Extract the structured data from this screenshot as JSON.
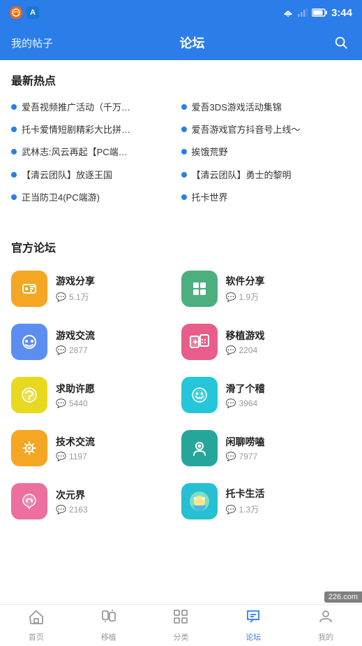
{
  "statusBar": {
    "time": "3:44",
    "icons": [
      "sohu",
      "a-blue"
    ]
  },
  "topNav": {
    "leftLabel": "我的帖子",
    "title": "论坛",
    "rightIcon": "search"
  },
  "hotSection": {
    "title": "最新热点",
    "items": [
      {
        "text": "爱吾视频推广活动（千万…"
      },
      {
        "text": "爱吾3DS游戏活动集锦"
      },
      {
        "text": "托卡爱情短剧精彩大比拼…"
      },
      {
        "text": "爱吾游戏官方抖音号上线～"
      },
      {
        "text": "武林志:风云再起【PC端…"
      },
      {
        "text": "挨饿荒野"
      },
      {
        "text": "【清云团队】放逐王国"
      },
      {
        "text": "【清云团队】勇士的黎明"
      },
      {
        "text": "正当防卫4(PC端游)"
      },
      {
        "text": "托卡世界"
      }
    ]
  },
  "forumSection": {
    "title": "官方论坛",
    "items": [
      {
        "name": "游戏分享",
        "count": "5.1万",
        "bg": "#f5a623",
        "icon": "🕹️"
      },
      {
        "name": "软件分享",
        "count": "1.9万",
        "bg": "#4caf7d",
        "icon": "⊞"
      },
      {
        "name": "游戏交流",
        "count": "2877",
        "bg": "#5b8ef0",
        "icon": "🎮"
      },
      {
        "name": "移植游戏",
        "count": "2204",
        "bg": "#e85d8a",
        "icon": "🎮"
      },
      {
        "name": "求助许愿",
        "count": "5440",
        "bg": "#f5d020",
        "icon": "😊"
      },
      {
        "name": "滑了个稽",
        "count": "3964",
        "bg": "#26c6da",
        "icon": "😄"
      },
      {
        "name": "技术交流",
        "count": "1197",
        "bg": "#f5a623",
        "icon": "🔧"
      },
      {
        "name": "闲聊唠嗑",
        "count": "7977",
        "bg": "#26a69a",
        "icon": "👤"
      },
      {
        "name": "次元界",
        "count": "2163",
        "bg": "#ec6f9e",
        "icon": "🦊"
      },
      {
        "name": "托卡生活",
        "count": "1.3万",
        "bg": "#26bfd4",
        "icon": "🌍"
      }
    ]
  },
  "bottomNav": {
    "items": [
      {
        "label": "首页",
        "icon": "home",
        "active": false
      },
      {
        "label": "移植",
        "icon": "migrate",
        "active": false
      },
      {
        "label": "分类",
        "icon": "category",
        "active": false
      },
      {
        "label": "论坛",
        "icon": "forum",
        "active": true
      },
      {
        "label": "我的",
        "icon": "user",
        "active": false
      }
    ]
  },
  "watermark": "226.com"
}
